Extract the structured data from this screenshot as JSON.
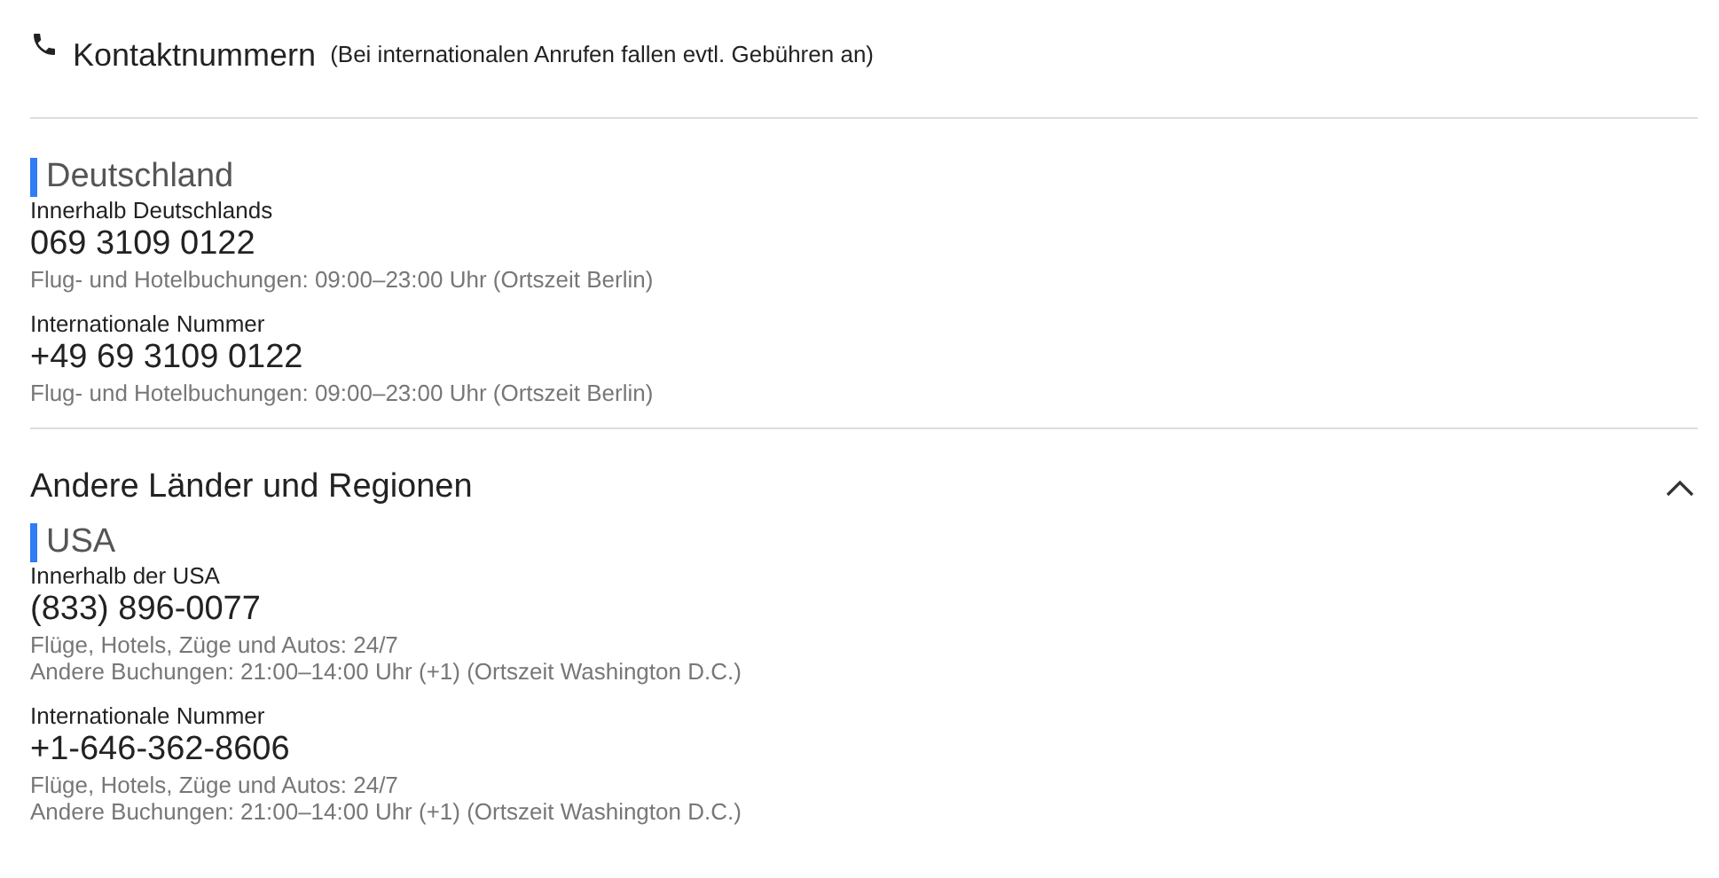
{
  "header": {
    "title": "Kontaktnummern",
    "note": "(Bei internationalen Anrufen fallen evtl. Gebühren an)"
  },
  "sections": [
    {
      "countries": [
        {
          "name": "Deutschland",
          "numbers": [
            {
              "label": "Innerhalb Deutschlands",
              "number": "069 3109 0122",
              "notes": [
                "Flug- und Hotelbuchungen: 09:00–23:00 Uhr (Ortszeit Berlin)"
              ]
            },
            {
              "label": "Internationale Nummer",
              "number": "+49 69 3109 0122",
              "notes": [
                "Flug- und Hotelbuchungen: 09:00–23:00 Uhr (Ortszeit Berlin)"
              ]
            }
          ]
        }
      ]
    },
    {
      "title": "Andere Länder und Regionen",
      "expanded": true,
      "countries": [
        {
          "name": "USA",
          "numbers": [
            {
              "label": "Innerhalb der USA",
              "number": "(833) 896-0077",
              "notes": [
                "Flüge, Hotels, Züge und Autos: 24/7",
                "Andere Buchungen: 21:00–14:00 Uhr (+1) (Ortszeit Washington D.C.)"
              ]
            },
            {
              "label": "Internationale Nummer",
              "number": "+1-646-362-8606",
              "notes": [
                "Flüge, Hotels, Züge und Autos: 24/7",
                "Andere Buchungen: 21:00–14:00 Uhr (+1) (Ortszeit Washington D.C.)"
              ]
            }
          ]
        }
      ]
    }
  ]
}
